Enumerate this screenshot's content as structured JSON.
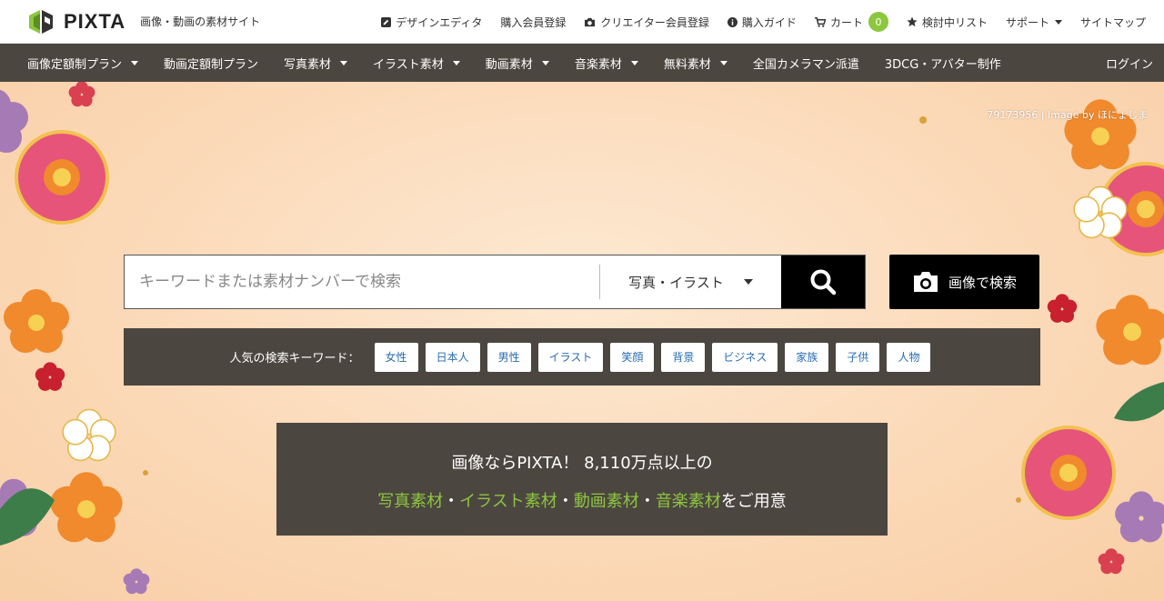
{
  "header": {
    "logo_text": "PIXTA",
    "tagline": "画像・動画の素材サイト",
    "nav": [
      {
        "label": "デザインエディタ",
        "icon": "edit-icon"
      },
      {
        "label": "購入会員登録"
      },
      {
        "label": "クリエイター会員登録",
        "icon": "camera-icon"
      },
      {
        "label": "購入ガイド",
        "icon": "info-icon"
      },
      {
        "label": "カート",
        "icon": "cart-icon",
        "badge": "0"
      },
      {
        "label": "検討中リスト",
        "icon": "star-icon"
      },
      {
        "label": "サポート",
        "dropdown": true
      },
      {
        "label": "サイトマップ"
      }
    ]
  },
  "catnav": {
    "items": [
      {
        "label": "画像定額制プラン",
        "dropdown": true
      },
      {
        "label": "動画定額制プラン"
      },
      {
        "label": "写真素材",
        "dropdown": true
      },
      {
        "label": "イラスト素材",
        "dropdown": true
      },
      {
        "label": "動画素材",
        "dropdown": true
      },
      {
        "label": "音楽素材",
        "dropdown": true
      },
      {
        "label": "無料素材",
        "dropdown": true
      },
      {
        "label": "全国カメラマン派遣"
      },
      {
        "label": "3DCG・アバター制作"
      }
    ],
    "login": "ログイン"
  },
  "hero": {
    "credit": "79173956 | Image by ほにょじま"
  },
  "search": {
    "placeholder": "キーワードまたは素材ナンバーで検索",
    "value": "",
    "type_selected": "写真・イラスト",
    "image_search_label": "画像で検索"
  },
  "popular": {
    "label": "人気の検索キーワード：",
    "keywords": [
      "女性",
      "日本人",
      "男性",
      "イラスト",
      "笑顔",
      "背景",
      "ビジネス",
      "家族",
      "子供",
      "人物"
    ]
  },
  "promo": {
    "line1": "画像ならPIXTA！ 8,110万点以上の",
    "line2_parts": [
      "写真素材",
      "・",
      "イラスト素材",
      "・",
      "動画素材",
      "・",
      "音楽素材",
      "をご用意"
    ]
  },
  "colors": {
    "accent_green": "#8dc63f",
    "nav_bg": "#4c4640",
    "keyword_text": "#2a6bb0"
  }
}
